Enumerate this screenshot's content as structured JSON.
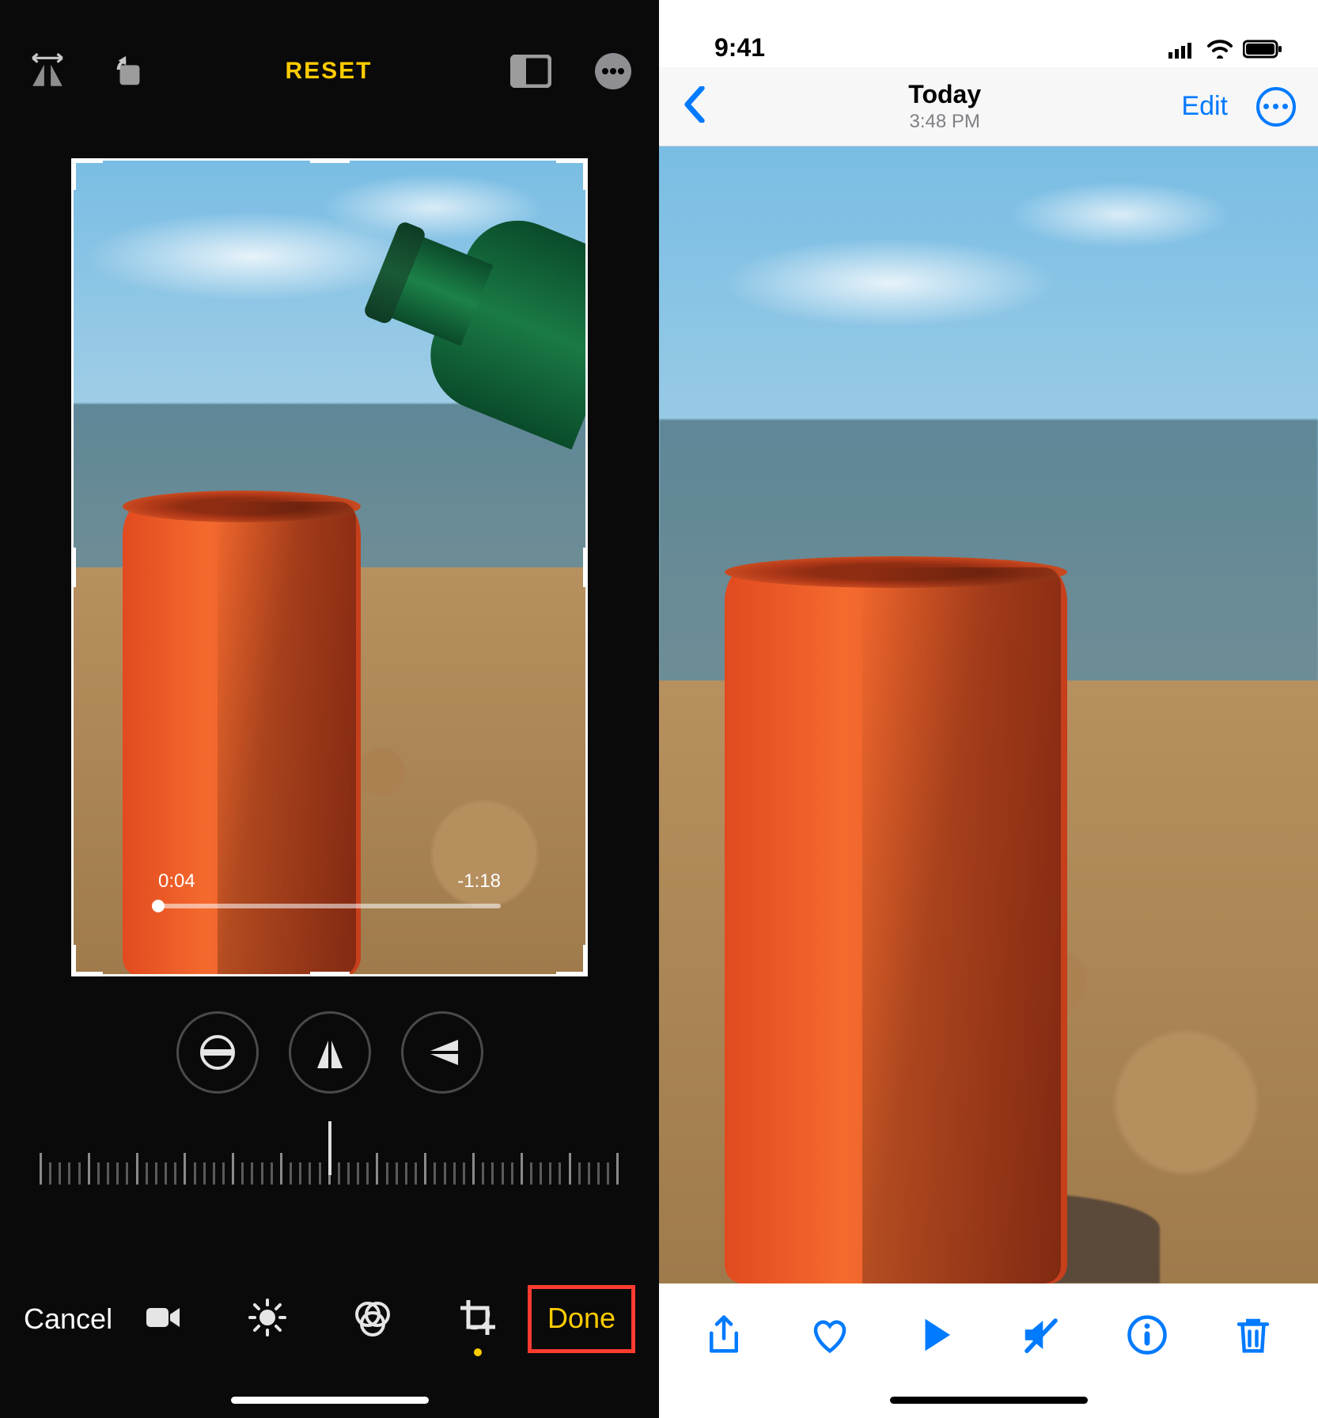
{
  "left": {
    "topbar": {
      "reset_label": "RESET"
    },
    "scrub": {
      "elapsed": "0:04",
      "remaining": "-1:18"
    },
    "tabbar": {
      "cancel_label": "Cancel",
      "done_label": "Done"
    }
  },
  "right": {
    "status": {
      "clock": "9:41"
    },
    "navbar": {
      "title": "Today",
      "subtitle": "3:48 PM",
      "edit_label": "Edit"
    }
  },
  "colors": {
    "accent_yellow": "#ffcc00",
    "ios_blue": "#007aff",
    "highlight_red": "#ff3b2f"
  }
}
